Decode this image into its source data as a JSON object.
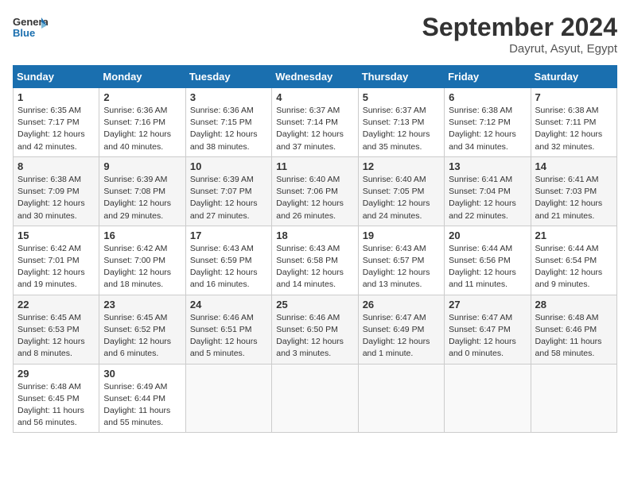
{
  "logo": {
    "line1": "General",
    "line2": "Blue"
  },
  "title": "September 2024",
  "location": "Dayrut, Asyut, Egypt",
  "days_header": [
    "Sunday",
    "Monday",
    "Tuesday",
    "Wednesday",
    "Thursday",
    "Friday",
    "Saturday"
  ],
  "weeks": [
    [
      {
        "num": "1",
        "rise": "6:35 AM",
        "set": "7:17 PM",
        "daylight": "12 hours and 42 minutes."
      },
      {
        "num": "2",
        "rise": "6:36 AM",
        "set": "7:16 PM",
        "daylight": "12 hours and 40 minutes."
      },
      {
        "num": "3",
        "rise": "6:36 AM",
        "set": "7:15 PM",
        "daylight": "12 hours and 38 minutes."
      },
      {
        "num": "4",
        "rise": "6:37 AM",
        "set": "7:14 PM",
        "daylight": "12 hours and 37 minutes."
      },
      {
        "num": "5",
        "rise": "6:37 AM",
        "set": "7:13 PM",
        "daylight": "12 hours and 35 minutes."
      },
      {
        "num": "6",
        "rise": "6:38 AM",
        "set": "7:12 PM",
        "daylight": "12 hours and 34 minutes."
      },
      {
        "num": "7",
        "rise": "6:38 AM",
        "set": "7:11 PM",
        "daylight": "12 hours and 32 minutes."
      }
    ],
    [
      {
        "num": "8",
        "rise": "6:38 AM",
        "set": "7:09 PM",
        "daylight": "12 hours and 30 minutes."
      },
      {
        "num": "9",
        "rise": "6:39 AM",
        "set": "7:08 PM",
        "daylight": "12 hours and 29 minutes."
      },
      {
        "num": "10",
        "rise": "6:39 AM",
        "set": "7:07 PM",
        "daylight": "12 hours and 27 minutes."
      },
      {
        "num": "11",
        "rise": "6:40 AM",
        "set": "7:06 PM",
        "daylight": "12 hours and 26 minutes."
      },
      {
        "num": "12",
        "rise": "6:40 AM",
        "set": "7:05 PM",
        "daylight": "12 hours and 24 minutes."
      },
      {
        "num": "13",
        "rise": "6:41 AM",
        "set": "7:04 PM",
        "daylight": "12 hours and 22 minutes."
      },
      {
        "num": "14",
        "rise": "6:41 AM",
        "set": "7:03 PM",
        "daylight": "12 hours and 21 minutes."
      }
    ],
    [
      {
        "num": "15",
        "rise": "6:42 AM",
        "set": "7:01 PM",
        "daylight": "12 hours and 19 minutes."
      },
      {
        "num": "16",
        "rise": "6:42 AM",
        "set": "7:00 PM",
        "daylight": "12 hours and 18 minutes."
      },
      {
        "num": "17",
        "rise": "6:43 AM",
        "set": "6:59 PM",
        "daylight": "12 hours and 16 minutes."
      },
      {
        "num": "18",
        "rise": "6:43 AM",
        "set": "6:58 PM",
        "daylight": "12 hours and 14 minutes."
      },
      {
        "num": "19",
        "rise": "6:43 AM",
        "set": "6:57 PM",
        "daylight": "12 hours and 13 minutes."
      },
      {
        "num": "20",
        "rise": "6:44 AM",
        "set": "6:56 PM",
        "daylight": "12 hours and 11 minutes."
      },
      {
        "num": "21",
        "rise": "6:44 AM",
        "set": "6:54 PM",
        "daylight": "12 hours and 9 minutes."
      }
    ],
    [
      {
        "num": "22",
        "rise": "6:45 AM",
        "set": "6:53 PM",
        "daylight": "12 hours and 8 minutes."
      },
      {
        "num": "23",
        "rise": "6:45 AM",
        "set": "6:52 PM",
        "daylight": "12 hours and 6 minutes."
      },
      {
        "num": "24",
        "rise": "6:46 AM",
        "set": "6:51 PM",
        "daylight": "12 hours and 5 minutes."
      },
      {
        "num": "25",
        "rise": "6:46 AM",
        "set": "6:50 PM",
        "daylight": "12 hours and 3 minutes."
      },
      {
        "num": "26",
        "rise": "6:47 AM",
        "set": "6:49 PM",
        "daylight": "12 hours and 1 minute."
      },
      {
        "num": "27",
        "rise": "6:47 AM",
        "set": "6:47 PM",
        "daylight": "12 hours and 0 minutes."
      },
      {
        "num": "28",
        "rise": "6:48 AM",
        "set": "6:46 PM",
        "daylight": "11 hours and 58 minutes."
      }
    ],
    [
      {
        "num": "29",
        "rise": "6:48 AM",
        "set": "6:45 PM",
        "daylight": "11 hours and 56 minutes."
      },
      {
        "num": "30",
        "rise": "6:49 AM",
        "set": "6:44 PM",
        "daylight": "11 hours and 55 minutes."
      },
      null,
      null,
      null,
      null,
      null
    ]
  ]
}
